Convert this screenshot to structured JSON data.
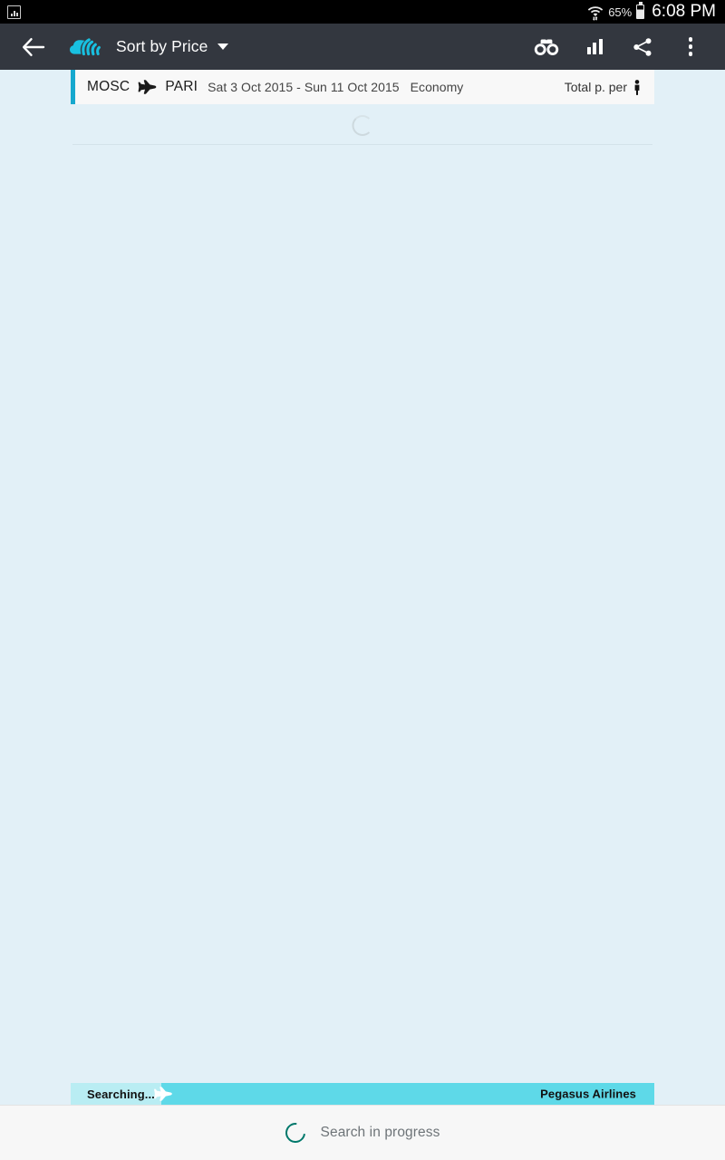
{
  "status_bar": {
    "left_icon": "screenshot-icon",
    "wifi_icon": "wifi-with-transfer-arrows-icon",
    "battery_percent": "65%",
    "battery_icon": "battery-icon",
    "time": "6:08 PM"
  },
  "toolbar": {
    "back_icon": "back-arrow-icon",
    "logo_icon": "skyscanner-cloud-logo",
    "sort_label": "Sort by Price",
    "caret_icon": "chevron-down-icon",
    "actions": [
      {
        "name": "watch-flight-button",
        "icon": "binoculars-icon"
      },
      {
        "name": "price-chart-button",
        "icon": "bar-chart-icon"
      },
      {
        "name": "share-button",
        "icon": "share-icon"
      },
      {
        "name": "overflow-menu-button",
        "icon": "kebab-menu-icon"
      }
    ]
  },
  "search_summary": {
    "origin": "MOSC",
    "plane_icon": "airplane-icon",
    "destination": "PARI",
    "dates": "Sat 3 Oct 2015 - Sun 11 Oct 2015",
    "cabin_class": "Economy",
    "price_mode": "Total p. per",
    "passenger_icon": "person-icon"
  },
  "results": {
    "spinner_icon": "loading-spinner",
    "items": []
  },
  "progress": {
    "label": "Searching...",
    "plane_icon": "airplane-icon",
    "current_airline": "Pegasus Airlines",
    "percent": 15.6
  },
  "bottom_bar": {
    "spinner_icon": "loading-spinner",
    "status_text": "Search in progress"
  },
  "colors": {
    "accent_cyan": "#16A8CE",
    "progress_cyan": "#5ED9E8",
    "progress_done": "#B9EDF3",
    "toolbar_dark": "#33373F",
    "page_background": "#E2F0F7",
    "teal_spinner": "#00786B"
  }
}
